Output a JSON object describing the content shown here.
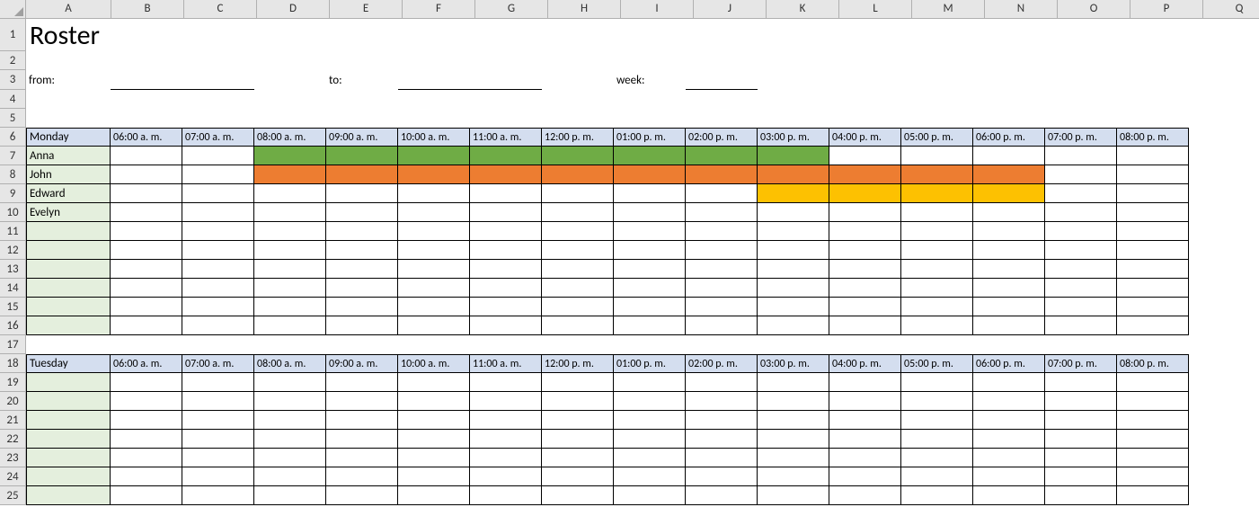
{
  "columns": [
    "A",
    "B",
    "C",
    "D",
    "E",
    "F",
    "G",
    "H",
    "I",
    "J",
    "K",
    "L",
    "M",
    "N",
    "O",
    "P",
    "Q"
  ],
  "colWidths": {
    "A": 94,
    "default": 80
  },
  "title": "Roster",
  "labels": {
    "from": "from:",
    "to": "to:",
    "week": "week:"
  },
  "times": [
    "06:00 a. m.",
    "07:00 a. m.",
    "08:00 a. m.",
    "09:00 a. m.",
    "10:00 a. m.",
    "11:00 a. m.",
    "12:00 p. m.",
    "01:00 p. m.",
    "02:00 p. m.",
    "03:00 p. m.",
    "04:00 p. m.",
    "05:00 p. m.",
    "06:00 p. m.",
    "07:00 p. m.",
    "08:00 p. m."
  ],
  "blocks": [
    {
      "day": "Monday",
      "headerRow": 6,
      "rows": [
        {
          "r": 7,
          "name": "Anna",
          "fills": [
            {
              "start": 2,
              "end": 9,
              "color": "green"
            }
          ]
        },
        {
          "r": 8,
          "name": "John",
          "fills": [
            {
              "start": 2,
              "end": 12,
              "color": "orange"
            }
          ]
        },
        {
          "r": 9,
          "name": "Edward",
          "fills": [
            {
              "start": 9,
              "end": 12,
              "color": "gold"
            }
          ]
        },
        {
          "r": 10,
          "name": "Evelyn",
          "fills": []
        },
        {
          "r": 11,
          "name": "",
          "fills": []
        },
        {
          "r": 12,
          "name": "",
          "fills": []
        },
        {
          "r": 13,
          "name": "",
          "fills": []
        },
        {
          "r": 14,
          "name": "",
          "fills": []
        },
        {
          "r": 15,
          "name": "",
          "fills": []
        },
        {
          "r": 16,
          "name": "",
          "fills": []
        }
      ]
    },
    {
      "day": "Tuesday",
      "headerRow": 18,
      "rows": [
        {
          "r": 19,
          "name": "",
          "fills": []
        },
        {
          "r": 20,
          "name": "",
          "fills": []
        },
        {
          "r": 21,
          "name": "",
          "fills": []
        },
        {
          "r": 22,
          "name": "",
          "fills": []
        },
        {
          "r": 23,
          "name": "",
          "fills": []
        },
        {
          "r": 24,
          "name": "",
          "fills": []
        },
        {
          "r": 25,
          "name": "",
          "fills": []
        }
      ]
    }
  ],
  "blankRows": [
    2,
    4,
    5,
    17
  ],
  "rowHeights": {
    "1": 36,
    "3": 22,
    "default": 21
  },
  "chart_data": {
    "type": "table",
    "title": "Roster",
    "columns": [
      "06:00 a. m.",
      "07:00 a. m.",
      "08:00 a. m.",
      "09:00 a. m.",
      "10:00 a. m.",
      "11:00 a. m.",
      "12:00 p. m.",
      "01:00 p. m.",
      "02:00 p. m.",
      "03:00 p. m.",
      "04:00 p. m.",
      "05:00 p. m.",
      "06:00 p. m.",
      "07:00 p. m.",
      "08:00 p. m."
    ],
    "days": [
      {
        "day": "Monday",
        "people": [
          {
            "name": "Anna",
            "shift_start": "08:00 a. m.",
            "shift_end": "03:00 p. m.",
            "color": "#6fac45"
          },
          {
            "name": "John",
            "shift_start": "08:00 a. m.",
            "shift_end": "07:00 p. m.",
            "color": "#ed7d31"
          },
          {
            "name": "Edward",
            "shift_start": "03:00 p. m.",
            "shift_end": "07:00 p. m.",
            "color": "#fdc101"
          },
          {
            "name": "Evelyn",
            "shift_start": null,
            "shift_end": null
          }
        ]
      },
      {
        "day": "Tuesday",
        "people": []
      }
    ]
  }
}
